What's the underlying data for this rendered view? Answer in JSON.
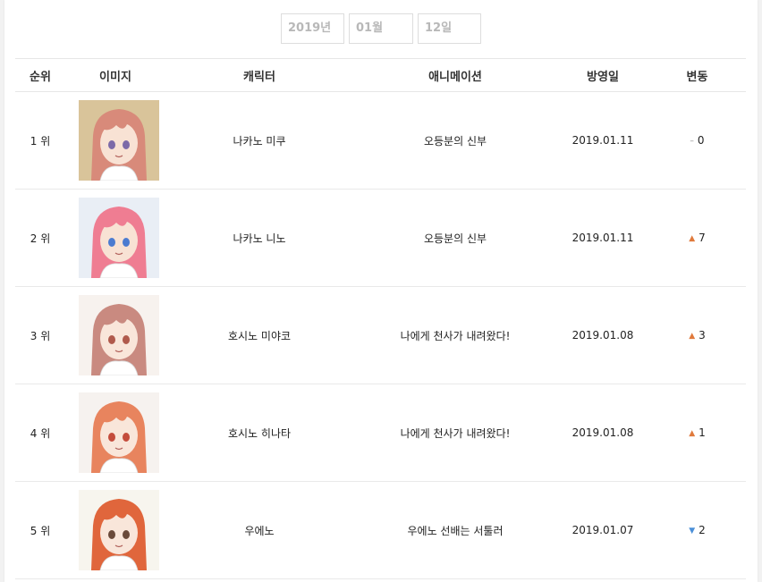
{
  "date_selector": {
    "year": "2019년",
    "month": "01월",
    "day": "12일"
  },
  "table": {
    "headers": [
      "순위",
      "이미지",
      "캐릭터",
      "애니메이션",
      "방영일",
      "변동"
    ],
    "rows": [
      {
        "rank": "1 위",
        "character": "나카노 미쿠",
        "anime": "오등분의 신부",
        "date": "2019.01.11",
        "change_dir": "same",
        "change_icon": "–",
        "change": "0",
        "hair": "#d88a7a",
        "bg": "#d9c49a",
        "skin": "#f8e2d4",
        "eyes": "#7c6aa8"
      },
      {
        "rank": "2 위",
        "character": "나카노 니노",
        "anime": "오등분의 신부",
        "date": "2019.01.11",
        "change_dir": "up",
        "change_icon": "▲",
        "change": "7",
        "hair": "#ef7d92",
        "bg": "#e9eef5",
        "skin": "#f8e2d4",
        "eyes": "#4b7bd0"
      },
      {
        "rank": "3 위",
        "character": "호시노 미야코",
        "anime": "나에게 천사가 내려왔다!",
        "date": "2019.01.08",
        "change_dir": "up",
        "change_icon": "▲",
        "change": "3",
        "hair": "#c98a80",
        "bg": "#f7f2ee",
        "skin": "#f9e6da",
        "eyes": "#b05a4c"
      },
      {
        "rank": "4 위",
        "character": "호시노 히나타",
        "anime": "나에게 천사가 내려왔다!",
        "date": "2019.01.08",
        "change_dir": "up",
        "change_icon": "▲",
        "change": "1",
        "hair": "#e8845e",
        "bg": "#f6f2ef",
        "skin": "#f9e6da",
        "eyes": "#c44c3c"
      },
      {
        "rank": "5 위",
        "character": "우에노",
        "anime": "우에노 선배는 서툴러",
        "date": "2019.01.07",
        "change_dir": "down",
        "change_icon": "▼",
        "change": "2",
        "hair": "#e0663c",
        "bg": "#f7f5ee",
        "skin": "#f9e6da",
        "eyes": "#6a4a3a"
      }
    ]
  }
}
